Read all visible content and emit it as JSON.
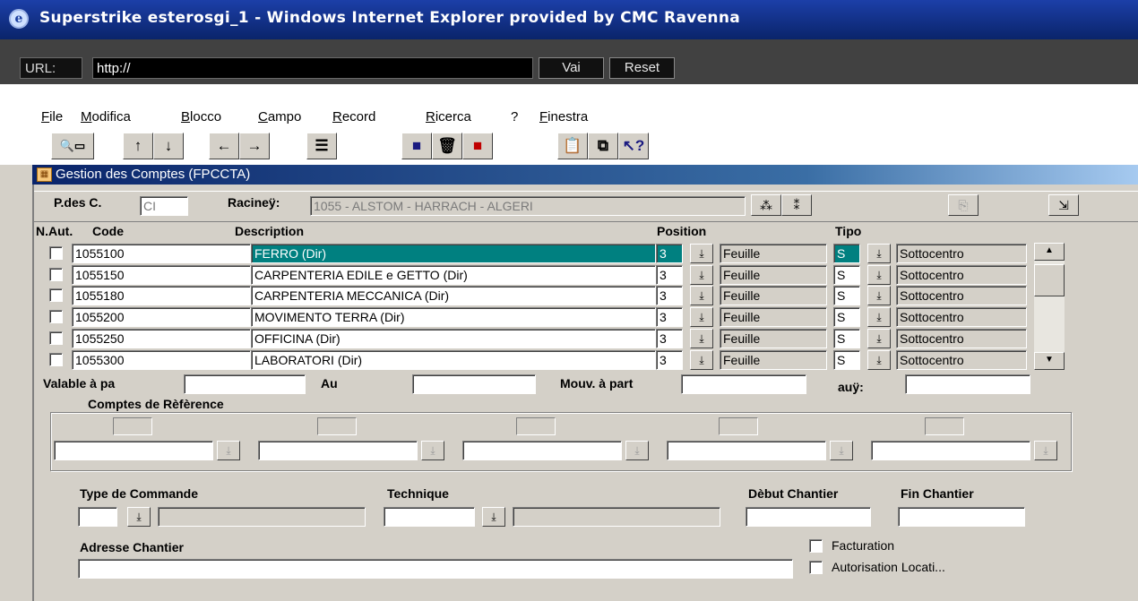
{
  "window": {
    "title": "Superstrike esterosgi_1 - Windows Internet Explorer provided by CMC Ravenna"
  },
  "urlbar": {
    "label": "URL:",
    "value": "http://",
    "go_label": "Vai",
    "reset_label": "Reset"
  },
  "menu": {
    "items": [
      {
        "key": "F",
        "rest": "ile"
      },
      {
        "key": "M",
        "rest": "odifica"
      },
      {
        "key": "B",
        "rest": "locco"
      },
      {
        "key": "C",
        "rest": "ampo"
      },
      {
        "key": "R",
        "rest": "ecord"
      },
      {
        "key": "R",
        "rest": "icerca"
      },
      {
        "key": "",
        "rest": "?"
      },
      {
        "key": "F",
        "rest": "inestra"
      }
    ]
  },
  "toolbar": {
    "buttons": [
      "search-records-icon",
      "arrow-up-icon",
      "arrow-down-icon",
      "arrow-left-icon",
      "arrow-right-icon",
      "list-icon",
      "save-icon",
      "delete-icon",
      "exit-icon",
      "clipboard-icon",
      "copy-icon",
      "help-pointer-icon"
    ]
  },
  "form": {
    "title": "Gestion des Comptes (FPCCTA)"
  },
  "header": {
    "pdesc_label": "P.des C.",
    "pdesc_value": "CI",
    "racine_label": "Racineÿ:",
    "racine_value": "1055 - ALSTOM - HARRACH - ALGERI"
  },
  "table": {
    "columns": {
      "naut": "N.Aut.",
      "code": "Code",
      "description": "Description",
      "position": "Position",
      "tipo": "Tipo"
    },
    "rows": [
      {
        "code": "1055100",
        "description": "FERRO (Dir)",
        "pos": "3",
        "pos_label": "Feuille",
        "tipo": "S",
        "tipo_label": "Sottocentro"
      },
      {
        "code": "1055150",
        "description": "CARPENTERIA EDILE e GETTO (Dir)",
        "pos": "3",
        "pos_label": "Feuille",
        "tipo": "S",
        "tipo_label": "Sottocentro"
      },
      {
        "code": "1055180",
        "description": "CARPENTERIA MECCANICA (Dir)",
        "pos": "3",
        "pos_label": "Feuille",
        "tipo": "S",
        "tipo_label": "Sottocentro"
      },
      {
        "code": "1055200",
        "description": "MOVIMENTO TERRA (Dir)",
        "pos": "3",
        "pos_label": "Feuille",
        "tipo": "S",
        "tipo_label": "Sottocentro"
      },
      {
        "code": "1055250",
        "description": "OFFICINA (Dir)",
        "pos": "3",
        "pos_label": "Feuille",
        "tipo": "S",
        "tipo_label": "Sottocentro"
      },
      {
        "code": "1055300",
        "description": "LABORATORI (Dir)",
        "pos": "3",
        "pos_label": "Feuille",
        "tipo": "S",
        "tipo_label": "Sottocentro"
      }
    ]
  },
  "dates": {
    "valable_label": "Valable à pa",
    "au_label": "Au",
    "mouv_label": "Mouv. à part",
    "auy_label": "auÿ:"
  },
  "comptes": {
    "legend": "Comptes de Rèfèrence"
  },
  "bottom": {
    "type_cmd_label": "Type de Commande",
    "technique_label": "Technique",
    "debut_label": "Dèbut Chantier",
    "fin_label": "Fin Chantier",
    "adresse_label": "Adresse Chantier",
    "facturation_label": "Facturation",
    "autorisation_label": "Autorisation Locati..."
  },
  "colors": {
    "title_bar": "#0a246a",
    "selected_row": "#008080",
    "window_bg": "#d4d0c8"
  }
}
